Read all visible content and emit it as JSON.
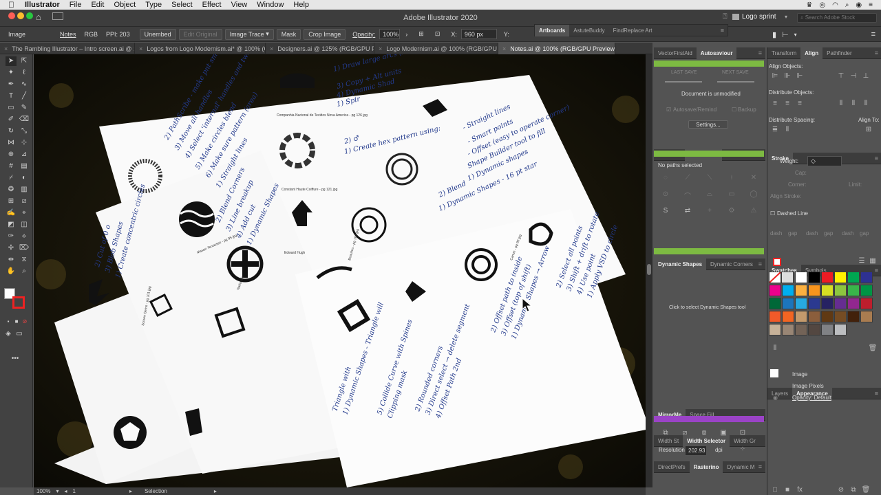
{
  "menubar": {
    "app": "Illustrator",
    "items": [
      "File",
      "Edit",
      "Object",
      "Type",
      "Select",
      "Effect",
      "View",
      "Window",
      "Help"
    ]
  },
  "appbar": {
    "title": "Adobe Illustrator 2020",
    "workspace": "Logo sprint",
    "search_placeholder": "Search Adobe Stock"
  },
  "control": {
    "object_type": "Image",
    "notes": "Notes",
    "color_mode": "RGB",
    "ppi": "PPI: 203",
    "unembed": "Unembed",
    "edit_original": "Edit Original",
    "image_trace": "Image Trace",
    "mask": "Mask",
    "crop": "Crop Image",
    "opacity_label": "Opacity:",
    "opacity_value": "100%",
    "x_label": "X:",
    "x_value": "960 px",
    "y_label": "Y:"
  },
  "artboard_panel": {
    "tabs": [
      "Artboards",
      "AstuteBuddy",
      "FindReplace Art"
    ]
  },
  "tabs": [
    {
      "label": "The Rambling Illustrator – Intro screen.ai @ 150..."
    },
    {
      "label": "Logos from Logo Modernism.ai* @ 100% (CMYK/..."
    },
    {
      "label": "Designers.ai @ 125% (RGB/GPU Previe..."
    },
    {
      "label": "Logo Modernism.ai @ 100% (RGB/GPU Previe..."
    },
    {
      "label": "Notes.ai @ 100% (RGB/GPU Preview)"
    }
  ],
  "status": {
    "zoom": "100%",
    "artboard": "1",
    "tool": "Selection"
  },
  "sheets": {
    "captions": [
      "Companhia Nacional de Tecidos Nova America - pg 126 jpg",
      "Constant Haute Coiffure - pg 121 jpg",
      "Edward Hugh",
      "Mason Terrasses - pg 95 jpg",
      "Nationale",
      "Screen Gems - pg 101 jpg",
      "Canon - pg 90 jpg",
      "Beaulieu - pg 104 jpg"
    ],
    "notes": [
      "1) Draw large arcs (2 have straight ext)",
      "2) Draw common circ",
      "3) Copy + Alt units",
      "4) Dynamic Shad",
      "1) Spir",
      "2) ♂",
      "1) Create hex pattern using:",
      "- Straight lines",
      "- Smart points",
      "- Offset (easy to operate corner)",
      "Shape Builder tool to fill",
      "1) Dynamic shapes",
      "2) Blend",
      "1) Dynamic Shapes - 16 pt star",
      "2) PathScribe - make pnt smooth",
      "3) Move all handles",
      "4) Select 'internal' handles and tweak",
      "5) Make circles blend",
      "6) Make sure pattern (area)",
      "1) Straight lines",
      "2) Blend Corners",
      "3) Line breakup",
      "4) Add cut",
      "1) Dynamic Shapes",
      "2) Cut of 0 o",
      "3) Blob Shapes",
      "1) Create concentric circles",
      "2) Select all points",
      "3) Shift + drift to rotate",
      "4) Use point",
      "1) Apply VSD to circle",
      "2) Offset path to inside",
      "3) Offset (top of shift)",
      "1) Dynamic Shapes → Arrow",
      "2) Rounded corners",
      "3) Direct select → delete segment",
      "4) Offset Path 2nd",
      "5) Collide Curve with Spines",
      "Clipping mask",
      "Triangle with",
      "1) Dynamic Shapes - Triangle will"
    ]
  },
  "panels": {
    "vf_tabs": [
      "VectorFirstAid",
      "Autosaviour"
    ],
    "last_save": "LAST SAVE",
    "next_save": "NEXT SAVE",
    "doc_status": "Document is unmodified",
    "autosave_label": "Autosave/Remind",
    "backup_label": "Backup",
    "settings": "Settings...",
    "ps_tabs": [
      "InkScribe",
      "PathScribe"
    ],
    "no_paths": "No paths selected",
    "ds_tabs": [
      "Dynamic Shapes",
      "Dynamic Corners"
    ],
    "ds_hint": "Click to select Dynamic Shapes tool",
    "mm_tabs": [
      "MirrorMe",
      "Space Fill"
    ],
    "ws_tabs": [
      "Width St",
      "Width Selector",
      "Width Gr"
    ],
    "dp_tabs": [
      "DirectPrefs",
      "Rasterino",
      "Dynamic M"
    ],
    "resolution_label": "Resolution:",
    "resolution_value": "202.93",
    "resolution_unit": "dpi",
    "tr_tabs": [
      "Transform",
      "Align",
      "Pathfinder"
    ],
    "align_objects": "Align Objects:",
    "distribute_objects": "Distribute Objects:",
    "distribute_spacing": "Distribute Spacing:",
    "align_to": "Align To:",
    "stroke_tab": "Stroke",
    "weight": "Weight:",
    "cap": "Cap:",
    "corner": "Corner:",
    "limit": "Limit:",
    "align_stroke": "Align Stroke:",
    "dashed": "Dashed Line",
    "dash": "dash",
    "gap": "gap",
    "sw_tabs": [
      "Swatches",
      "Symbols"
    ],
    "la_tabs": [
      "Layers",
      "Appearance"
    ],
    "app_image": "Image",
    "app_pixels": "Image Pixels",
    "app_opacity": "Opacity: Default"
  },
  "swatch_colors": [
    "#ffffff",
    "#000000",
    "#ed1c24",
    "#fff200",
    "#00a651",
    "#2e3192",
    "#ec008c",
    "#00aeef",
    "#fbb040",
    "#f7941d",
    "#d7df23",
    "#8dc63f",
    "#39b54a",
    "#009444",
    "#006838",
    "#1c75bc",
    "#27aae1",
    "#2b3990",
    "#262262",
    "#662d91",
    "#92278f",
    "#be1e2d",
    "#f15a29",
    "#f26522",
    "#c49a6c",
    "#8b5e3c",
    "#603913",
    "#754c24",
    "#42210b",
    "#a97c50",
    "#c7b299",
    "#998675",
    "#736357",
    "#534741",
    "#808285",
    "#bcbec0"
  ],
  "colors": {
    "accent_green": "#7dba42",
    "accent_purple": "#9a43c6",
    "canvas_bg": "#121008"
  }
}
